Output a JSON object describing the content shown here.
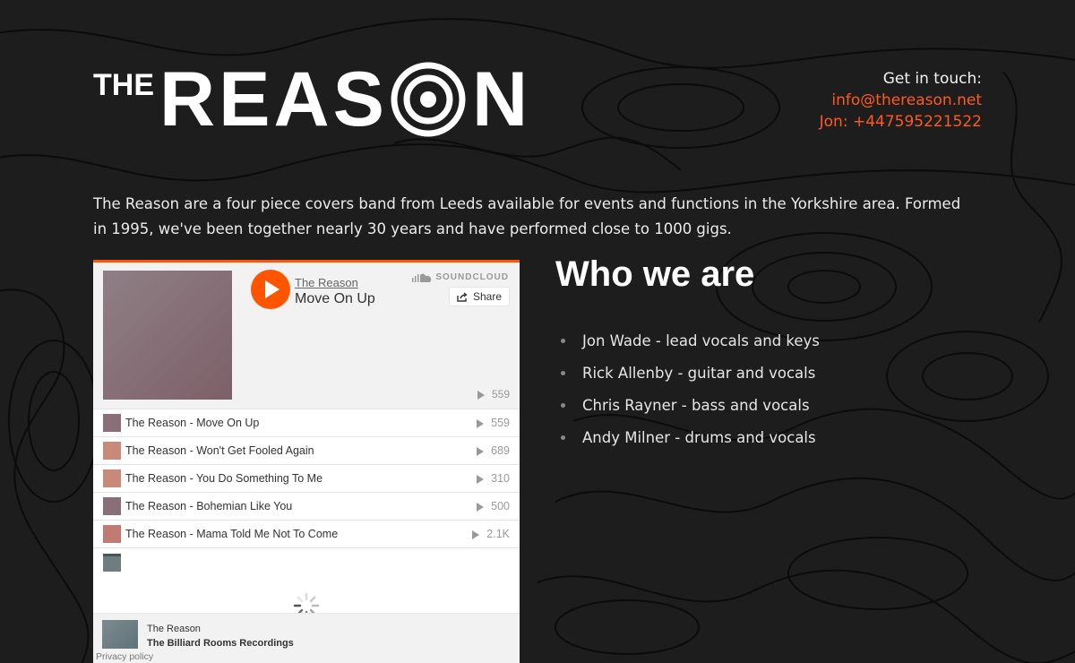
{
  "logo": {
    "the": "THE",
    "reason_left": "REAS",
    "reason_right": "N"
  },
  "contact": {
    "label": "Get in touch:",
    "email": "info@thereason.net",
    "phone": "Jon: +447595221522"
  },
  "intro": "The Reason are a four piece covers band from Leeds available for events and functions in the Yorkshire area. Formed in 1995, we've been together nearly 30 years and have performed close to 1000 gigs.",
  "soundcloud": {
    "brand": "SOUNDCLOUD",
    "share_label": "Share",
    "artist": "The Reason",
    "title": "Move On Up",
    "play_count": "559",
    "tracks": [
      {
        "title": "The Reason - Move On Up",
        "plays": "559",
        "thumb": "#8a6f78"
      },
      {
        "title": "The Reason - Won't Get Fooled Again",
        "plays": "689",
        "thumb": "#c98a7a"
      },
      {
        "title": "The Reason - You Do Something To Me",
        "plays": "310",
        "thumb": "#c98a7a"
      },
      {
        "title": "The Reason - Bohemian Like You",
        "plays": "500",
        "thumb": "#8a6f78"
      },
      {
        "title": "The Reason - Mama Told Me Not To Come",
        "plays": "2.1K",
        "thumb": "#c07b72"
      }
    ],
    "footer_user": "The Reason",
    "footer_set": "The Billiard Rooms Recordings",
    "privacy": "Privacy policy"
  },
  "who": {
    "title": "Who we are",
    "members": [
      "Jon Wade - lead vocals and keys",
      "Rick Allenby - guitar and vocals",
      "Chris Rayner - bass and vocals",
      "Andy Milner - drums and vocals"
    ]
  },
  "colors": {
    "accent": "#ff5a1f",
    "soundcloud": "#ff5500",
    "background": "#1d1d1d"
  }
}
